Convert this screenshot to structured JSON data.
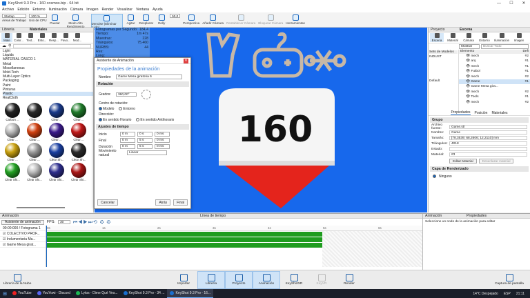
{
  "window": {
    "title": "KeyShot 9.3 Pro  -  160 cosmos.bip  -  64 bit",
    "min": "—",
    "max": "☐",
    "close": "✕"
  },
  "menu": [
    "Archivo",
    "Edición",
    "Entorno",
    "Iluminación",
    "Cámara",
    "Imagen",
    "Render",
    "Visualizar",
    "Ventana",
    "Ayuda"
  ],
  "toolbar": {
    "workspace_value": "Startup",
    "workspace_label": "Áreas de Trabajo",
    "cpu_value": "100 %",
    "cpu_label": "Uso de CPU",
    "pause_label": "Pausar",
    "hi_perf_label": "Modo Alto Rendimiento",
    "denoise_label": "Denoise (Eliminar ruido)",
    "tumble_label": "Agitar",
    "pan_label": "Desplazar",
    "dolly_label": "Dolly",
    "fov_value": "50,0",
    "perspective_label": "Perspectiva",
    "add_cam_label": "Añadir Cámara",
    "reset_cam_label": "Restablecer Cámara",
    "lock_cam_label": "Bloquear Cámara",
    "tools_label": "Herramientas"
  },
  "library": {
    "header": "Librería",
    "materials_header": "Materiales",
    "tabs": [
      "Mate",
      "Color...",
      "Text...",
      "Ento...",
      "Resp...",
      "Favo...",
      "Mod..."
    ],
    "tree": [
      "Light",
      "Liquids",
      "MATERIAL CASCO 1",
      "Metal",
      "Miscellaneous",
      "Mold-Tech",
      "Multi-Layer Optics",
      "Packaging",
      "Paint",
      "Pinturas",
      "Plastic",
      "RealCloth"
    ],
    "selected_tree": "Plastic",
    "materials": [
      {
        "name": "Carbon ...",
        "color": "#222"
      },
      {
        "name": "Clear ...",
        "color": "#2a2a2a"
      },
      {
        "name": "Clear ...",
        "color": "#1a3a8a"
      },
      {
        "name": "Clear ...",
        "color": "#1f7a2a"
      },
      {
        "name": "Clear ...",
        "color": "#b9b9b9"
      },
      {
        "name": "Clear ...",
        "color": "#d04010"
      },
      {
        "name": "Clear ...",
        "color": "#3a1a8a"
      },
      {
        "name": "Clear ...",
        "color": "#c01818"
      },
      {
        "name": "Clear ...",
        "color": "#c8a010"
      },
      {
        "name": "Clear ...",
        "color": "#9a9a9a"
      },
      {
        "name": "Clear Sh...",
        "color": "#1a3fa0"
      },
      {
        "name": "Clear Sh...",
        "color": "#2a2a2a"
      },
      {
        "name": "Clear Shi...",
        "color": "#23a023"
      },
      {
        "name": "Clear Shi...",
        "color": "#bbbbbb"
      },
      {
        "name": "Clear Shi...",
        "color": "#2d2d8c"
      },
      {
        "name": "Clear Shi...",
        "color": "#aa1515"
      }
    ]
  },
  "stats": [
    {
      "k": "Fotogramas por Segundo:",
      "v": "184,4"
    },
    {
      "k": "Tiempo:",
      "v": "1m 47s"
    },
    {
      "k": "Muestras:",
      "v": "228"
    },
    {
      "k": "Triángulos:",
      "v": "75.460"
    },
    {
      "k": "NURBS:",
      "v": "44"
    },
    {
      "k": "Res:",
      "v": ""
    },
    {
      "k": "Long:",
      "v": ""
    },
    {
      "k": "Desv:",
      "v": ""
    }
  ],
  "viewport": {
    "number": "160"
  },
  "dialog": {
    "title": "Asistente de Animación",
    "heading": "Propiedades de la animación",
    "name_label": "Nombre",
    "name_value": "Game Mesa giratoria 6",
    "rotation_section": "Rotación",
    "degrees_label": "Grados:",
    "degrees_value": "360,00°",
    "center_label": "Centro de rotación:",
    "center_model": "Modelo",
    "center_env": "Entorno",
    "direction_label": "Dirección:",
    "dir_cw": "En sentido Horario",
    "dir_ccw": "En sentido Antihorario",
    "time_section": "Ajustes de tiempo",
    "start_label": "Inicio",
    "end_label": "Final",
    "duration_label": "Duración",
    "start_vals": [
      "0 m",
      "0 s",
      "0 ms"
    ],
    "end_vals": [
      "0 m",
      "5 s",
      "0 ms"
    ],
    "duration_vals": [
      "0 m",
      "5 s",
      "0 ms"
    ],
    "motion_label": "Movimiento natural",
    "motion_value": "Linear",
    "cancel": "Cancelar",
    "back": "Atrás",
    "finish": "Final"
  },
  "project": {
    "header": "Proyecto",
    "scene_header": "Escena",
    "tabs": [
      "Escena",
      "Material",
      "Cámara",
      "Entorno",
      "Iluminación",
      "Imagen"
    ],
    "show_label": "Mostrar",
    "search_placeholder": "Buscar Todo",
    "model_sets_label": "Sets de Modelos",
    "model_set": "INDUST",
    "default_set": "Default",
    "element_col": "Elemento",
    "def_col": "Defi",
    "tree": [
      {
        "label": "mech",
        "def": "#2"
      },
      {
        "label": "arq",
        "def": "#1"
      },
      {
        "label": "mech",
        "def": "#1"
      },
      {
        "label": "Futbol",
        "def": "#1"
      },
      {
        "label": "mech",
        "def": "#2"
      },
      {
        "label": "Game",
        "def": "#1",
        "sel": true
      },
      {
        "label": "Game Mesa gira...",
        "def": ""
      },
      {
        "label": "mech",
        "def": "#2"
      },
      {
        "label": "Tools",
        "def": "#1"
      },
      {
        "label": "mech",
        "def": "#2"
      }
    ],
    "prop_tabs": [
      "Propiedades",
      "Posición",
      "Materiales"
    ],
    "group_section": "Grupo",
    "props": [
      {
        "k": "Archivo fuente:",
        "v": "Game.stl"
      },
      {
        "k": "Nombre:",
        "v": "Game"
      },
      {
        "k": "Tamaño:",
        "v": "[78,3539; 68,2606; 12,2110] mm"
      },
      {
        "k": "Triángulos:",
        "v": "4018"
      },
      {
        "k": "Estado:",
        "v": ""
      },
      {
        "k": "Material:",
        "v": "#3"
      }
    ],
    "edit_material": "Editar Material",
    "unlink_material": "Desenlazar material",
    "render_layer_section": "Capa de Renderizado",
    "render_layer": "Ninguno"
  },
  "animation": {
    "header": "Animación",
    "timeline_header": "Línea de tiempo",
    "wizard_btn": "Asistente de animación",
    "fps_label": "FPS:",
    "fps_value": "30",
    "frame_label": "00:00:000 / Fotograma 1",
    "tracks": [
      "COLECTIVO PROF...",
      "Indumentaria Ma...",
      "Game Mesa girat..."
    ],
    "ticks": [
      "0s",
      "1s",
      "2s",
      "3s",
      "4s",
      "5s",
      "6s"
    ]
  },
  "anim_props": {
    "header": "Animación",
    "props_header": "Propiedades",
    "hint": "Seleccione un nodo de la animación para editar"
  },
  "dock": [
    {
      "label": "Librería de la Nube"
    },
    {
      "label": "Importar"
    },
    {
      "label": "Librería",
      "active": true
    },
    {
      "label": "Proyecto",
      "active": true
    },
    {
      "label": "Animación",
      "active": true
    },
    {
      "label": "KeyShotXR"
    },
    {
      "label": "KeyVR"
    },
    {
      "label": "Render"
    },
    {
      "label": "Captura de pantalla"
    }
  ],
  "taskbar": {
    "apps": [
      {
        "label": "YouTube",
        "color": "#e22"
      },
      {
        "label": "YouYowi - Discord",
        "color": "#5865f2"
      },
      {
        "label": "Lytos - Dime Qué Ves...",
        "color": "#1db954"
      },
      {
        "label": "KeyShot 9.3 Pro - 34 ...",
        "color": "#1a6fd0"
      },
      {
        "label": "KeyShot 9.3 Pro - 16...",
        "color": "#1a6fd0",
        "active": true
      }
    ],
    "weather": "14°C  Despejado",
    "lang": "ESP",
    "time": "21:11"
  }
}
